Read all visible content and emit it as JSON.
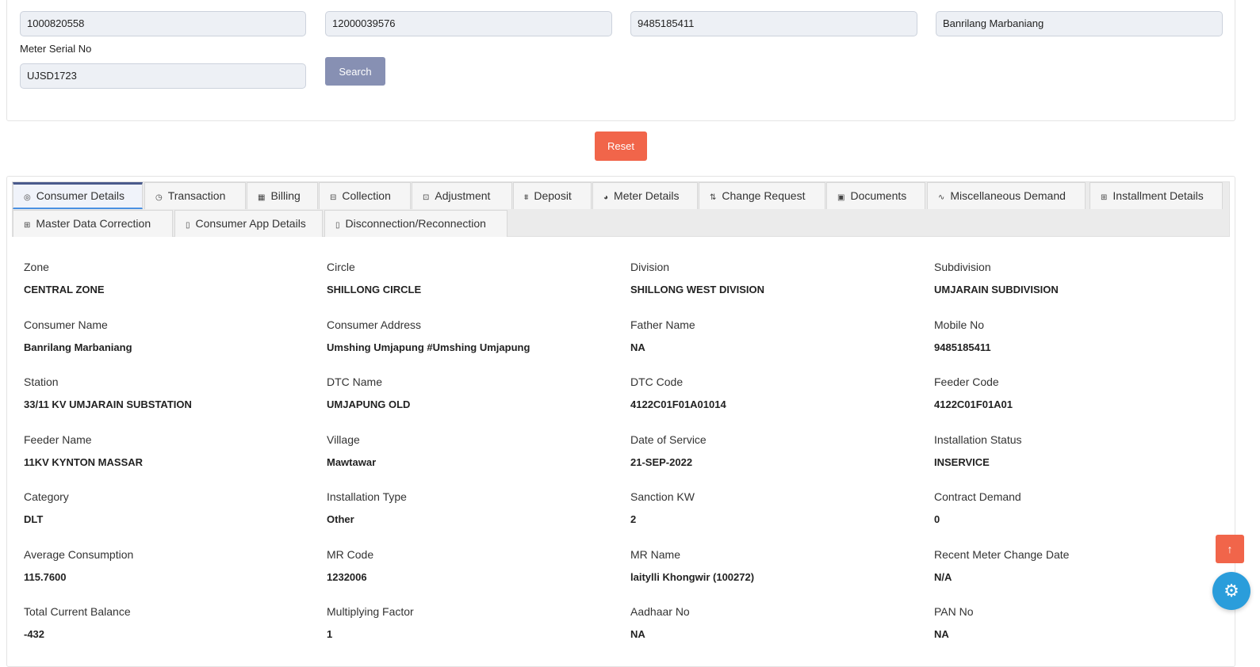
{
  "search": {
    "fields": [
      "1000820558",
      "12000039576",
      "9485185411",
      "Banrilang Marbaniang"
    ],
    "meter_label": "Meter Serial No",
    "meter_value": "UJSD1723",
    "search_label": "Search",
    "reset_label": "Reset"
  },
  "tabs": [
    {
      "label": "Consumer Details",
      "icon": "◎"
    },
    {
      "label": "Transaction",
      "icon": "◷"
    },
    {
      "label": "Billing",
      "icon": "▦"
    },
    {
      "label": "Collection",
      "icon": "⊟"
    },
    {
      "label": "Adjustment",
      "icon": "⊡"
    },
    {
      "label": "Deposit",
      "icon": "⩩"
    },
    {
      "label": "Meter Details",
      "icon": "◕"
    },
    {
      "label": "Change Request",
      "icon": "⇅"
    },
    {
      "label": "Documents",
      "icon": "▣"
    },
    {
      "label": "Miscellaneous Demand",
      "icon": "∿"
    },
    {
      "label": "Installment Details",
      "icon": "⊞"
    },
    {
      "label": "Master Data Correction",
      "icon": "⊞"
    },
    {
      "label": "Consumer App Details",
      "icon": "▯"
    },
    {
      "label": "Disconnection/Reconnection",
      "icon": "▯"
    }
  ],
  "details": [
    {
      "k": "Zone",
      "v": "CENTRAL ZONE"
    },
    {
      "k": "Circle",
      "v": "SHILLONG CIRCLE"
    },
    {
      "k": "Division",
      "v": "SHILLONG WEST DIVISION"
    },
    {
      "k": "Subdivision",
      "v": "UMJARAIN SUBDIVISION"
    },
    {
      "k": "Consumer Name",
      "v": "Banrilang Marbaniang"
    },
    {
      "k": "Consumer Address",
      "v": "Umshing Umjapung #Umshing Umjapung"
    },
    {
      "k": "Father Name",
      "v": "NA"
    },
    {
      "k": "Mobile No",
      "v": "9485185411"
    },
    {
      "k": "Station",
      "v": "33/11 KV UMJARAIN SUBSTATION"
    },
    {
      "k": "DTC Name",
      "v": "UMJAPUNG OLD"
    },
    {
      "k": "DTC Code",
      "v": "4122C01F01A01014"
    },
    {
      "k": "Feeder Code",
      "v": "4122C01F01A01"
    },
    {
      "k": "Feeder Name",
      "v": "11KV KYNTON MASSAR"
    },
    {
      "k": "Village",
      "v": "Mawtawar"
    },
    {
      "k": "Date of Service",
      "v": "21-SEP-2022"
    },
    {
      "k": "Installation Status",
      "v": "INSERVICE"
    },
    {
      "k": "Category",
      "v": "DLT"
    },
    {
      "k": "Installation Type",
      "v": "Other"
    },
    {
      "k": "Sanction KW",
      "v": "2"
    },
    {
      "k": "Contract Demand",
      "v": "0"
    },
    {
      "k": "Average Consumption",
      "v": "115.7600"
    },
    {
      "k": "MR Code",
      "v": "1232006"
    },
    {
      "k": "MR Name",
      "v": "laitylli Khongwir (100272)"
    },
    {
      "k": "Recent Meter Change Date",
      "v": "N/A"
    },
    {
      "k": "Total Current Balance",
      "v": "-432"
    },
    {
      "k": "Multiplying Factor",
      "v": "1"
    },
    {
      "k": "Aadhaar No",
      "v": "NA"
    },
    {
      "k": "PAN No",
      "v": "NA"
    }
  ],
  "colors": {
    "search_btn": "#8790b3",
    "reset_btn": "#f1654a",
    "scroll_top": "#f1654a",
    "settings": "#2a9ddb"
  }
}
